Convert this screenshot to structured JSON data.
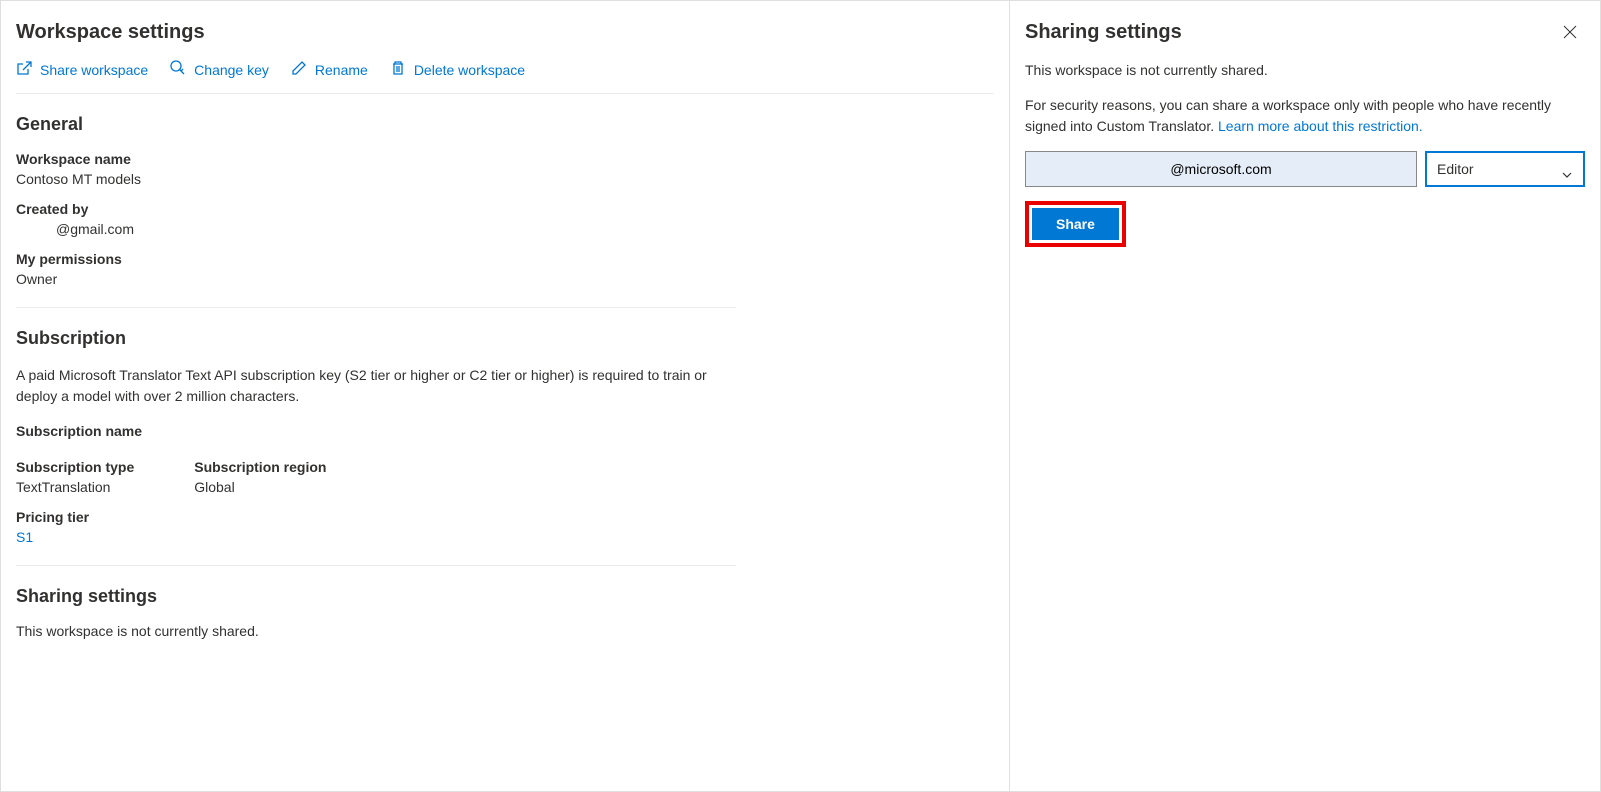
{
  "main": {
    "title": "Workspace settings",
    "toolbar": {
      "share": "Share workspace",
      "changeKey": "Change key",
      "rename": "Rename",
      "delete": "Delete workspace"
    },
    "general": {
      "heading": "General",
      "workspaceNameLabel": "Workspace name",
      "workspaceNameValue": "Contoso MT models",
      "createdByLabel": "Created by",
      "createdByValue": "@gmail.com",
      "permissionsLabel": "My permissions",
      "permissionsValue": "Owner"
    },
    "subscription": {
      "heading": "Subscription",
      "description": "A paid Microsoft Translator Text API subscription key (S2 tier or higher or C2 tier or higher) is required to train or deploy a model with over 2 million characters.",
      "nameLabel": "Subscription name",
      "typeLabel": "Subscription type",
      "typeValue": "TextTranslation",
      "regionLabel": "Subscription region",
      "regionValue": "Global",
      "tierLabel": "Pricing tier",
      "tierValue": "S1"
    },
    "sharing": {
      "heading": "Sharing settings",
      "status": "This workspace is not currently shared."
    }
  },
  "panel": {
    "title": "Sharing settings",
    "status": "This workspace is not currently shared.",
    "securityNote": "For security reasons, you can share a workspace only with people who have recently signed into Custom Translator. ",
    "learnMore": "Learn more about this restriction.",
    "emailValue": "@microsoft.com",
    "roleValue": "Editor",
    "shareButton": "Share"
  }
}
